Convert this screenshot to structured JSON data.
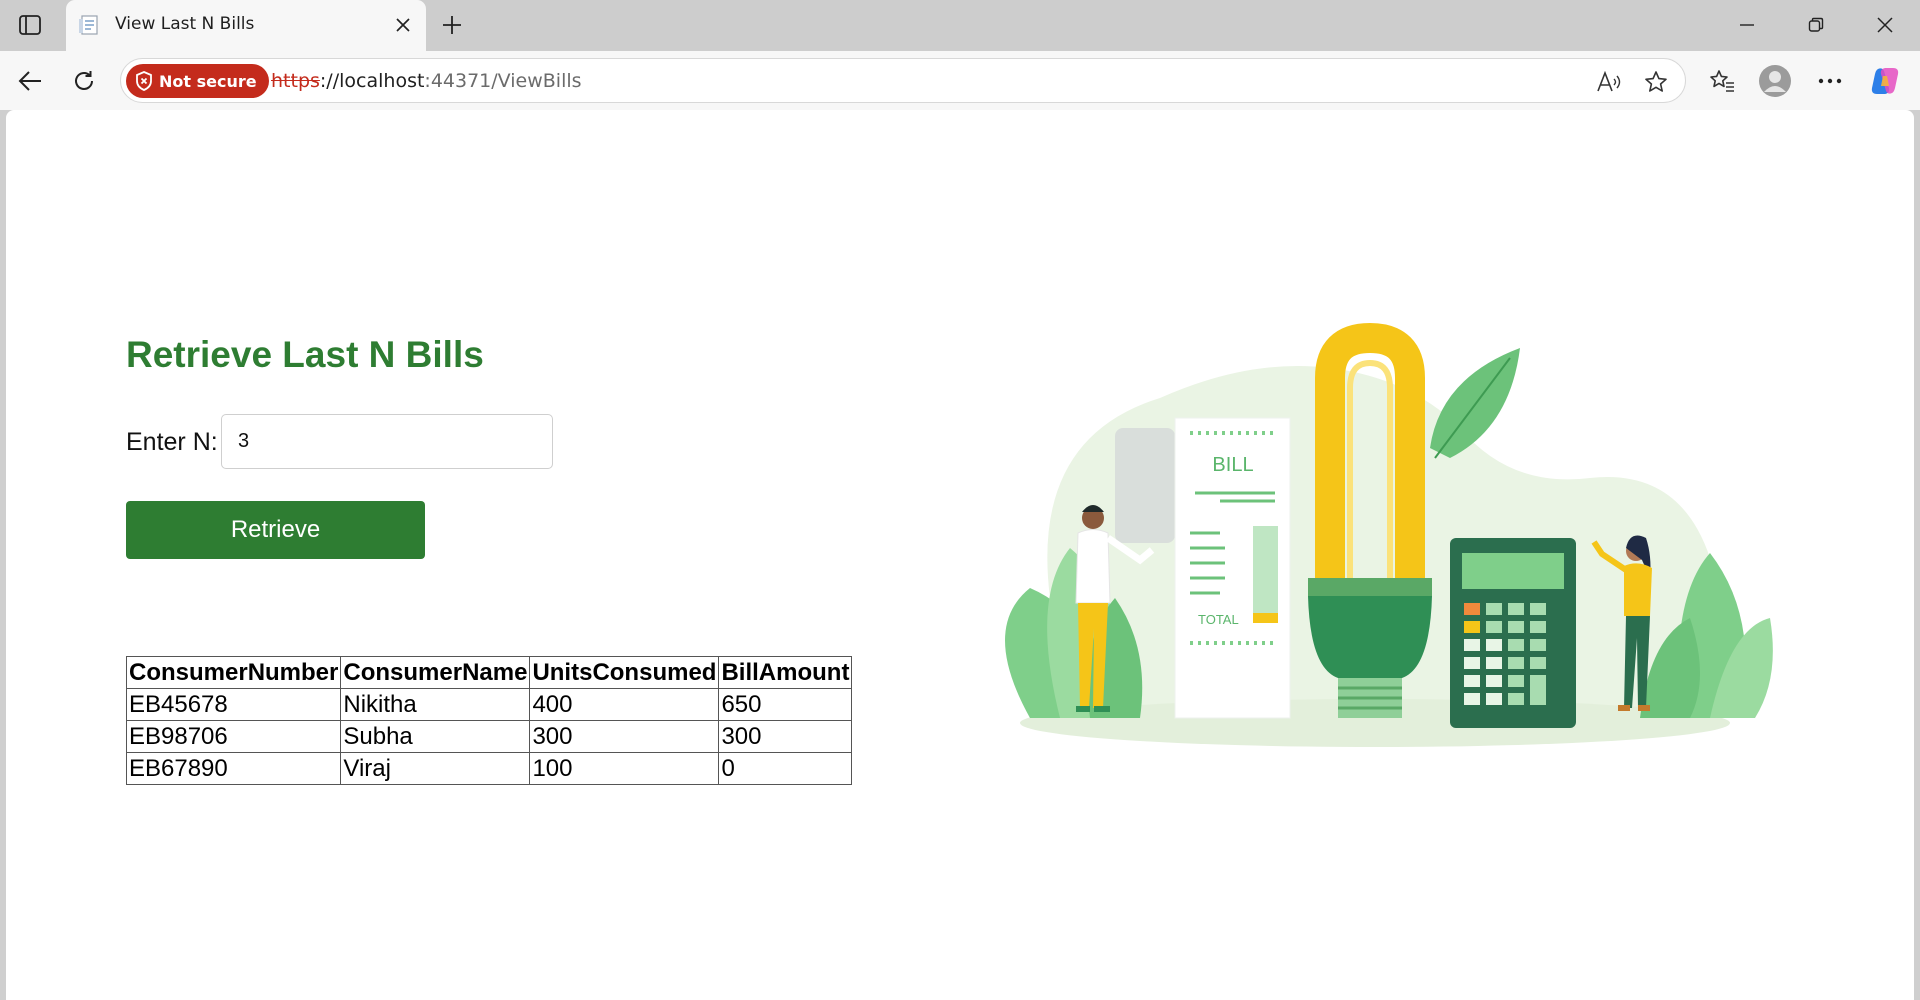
{
  "browser": {
    "tab_title": "View Last N Bills",
    "security_label": "Not secure",
    "url_scheme": "https",
    "url_sep": "://",
    "url_host": "localhost",
    "url_path": ":44371/ViewBills"
  },
  "page": {
    "heading": "Retrieve Last N Bills",
    "n_label": "Enter N:",
    "n_value": "3",
    "retrieve_label": "Retrieve"
  },
  "table": {
    "headers": [
      "ConsumerNumber",
      "ConsumerName",
      "UnitsConsumed",
      "BillAmount"
    ],
    "rows": [
      [
        "EB45678",
        "Nikitha",
        "400",
        "650"
      ],
      [
        "EB98706",
        "Subha",
        "300",
        "300"
      ],
      [
        "EB67890",
        "Viraj",
        "100",
        "0"
      ]
    ]
  },
  "illustration": {
    "bill_title": "BILL",
    "total_label": "TOTAL"
  },
  "colors": {
    "accent_green": "#2e7d32",
    "not_secure_red": "#c42b1c"
  }
}
